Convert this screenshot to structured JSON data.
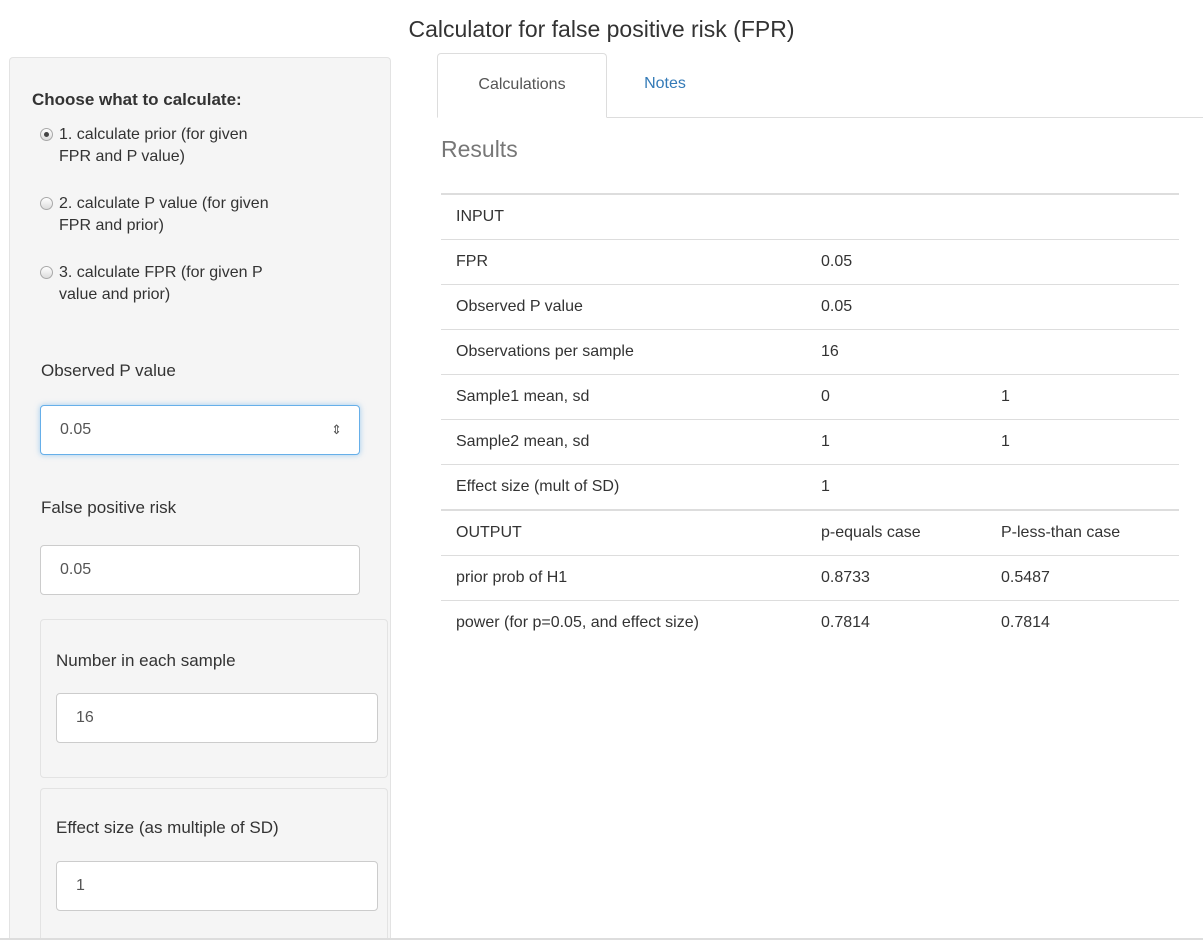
{
  "title": "Calculator for false positive risk (FPR)",
  "sidebar": {
    "heading": "Choose what to calculate:",
    "options": [
      {
        "line1": "1. calculate prior (for given",
        "line2": "FPR and P value)",
        "checked": true
      },
      {
        "line1": "2. calculate P value (for given",
        "line2": "FPR and prior)",
        "checked": false
      },
      {
        "line1": "3. calculate FPR (for given P",
        "line2": "value and prior)",
        "checked": false
      }
    ],
    "pvalue_label": "Observed P value",
    "pvalue_value": "0.05",
    "fpr_label": "False positive risk",
    "fpr_value": "0.05",
    "n_label": "Number in each sample",
    "n_value": "16",
    "effect_label": "Effect size (as multiple of SD)",
    "effect_value": "1"
  },
  "tabs": {
    "calculations": "Calculations",
    "notes": "Notes"
  },
  "results": {
    "heading": "Results",
    "rows": [
      [
        "INPUT",
        "",
        ""
      ],
      [
        "FPR",
        "0.05",
        ""
      ],
      [
        "Observed P value",
        "0.05",
        ""
      ],
      [
        "Observations per sample",
        "16",
        ""
      ],
      [
        "Sample1 mean, sd",
        "0",
        "1"
      ],
      [
        "Sample2 mean, sd",
        "1",
        "1"
      ],
      [
        "Effect size (mult of SD)",
        "1",
        ""
      ],
      [
        "OUTPUT",
        "p-equals case",
        "P-less-than case"
      ],
      [
        "prior prob of H1",
        "0.8733",
        "0.5487"
      ],
      [
        "power (for p=0.05, and effect size)",
        "0.7814",
        "0.7814"
      ]
    ]
  },
  "colors": {
    "link": "#337ab7",
    "sidebar_bg": "#f5f5f5",
    "focus": "#66afe9"
  }
}
